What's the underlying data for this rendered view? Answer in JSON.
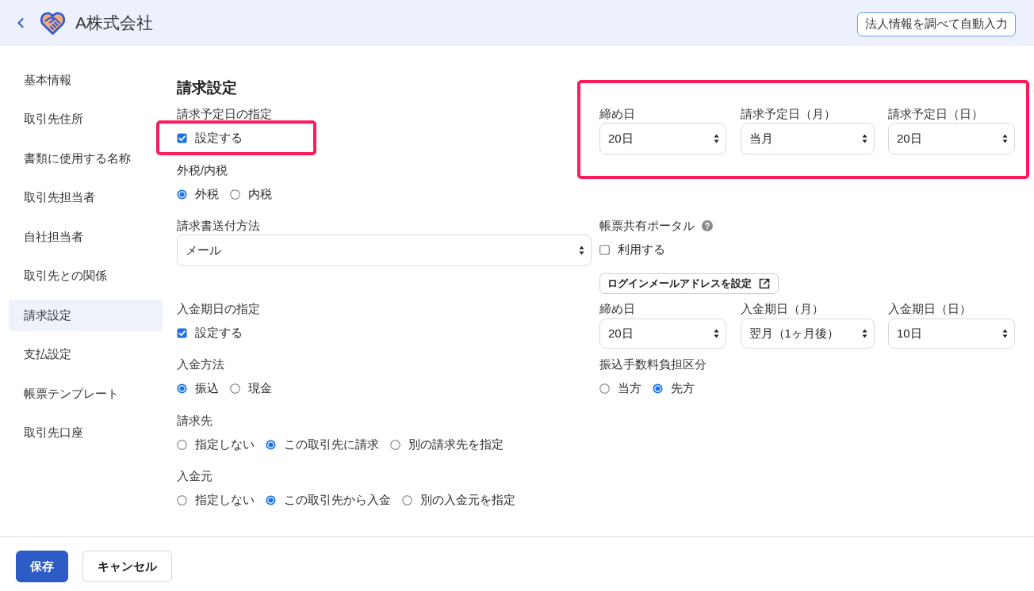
{
  "header": {
    "title": "A株式会社",
    "autofill_button": "法人情報を調べて自動入力"
  },
  "sidebar": {
    "items": [
      {
        "label": "基本情報",
        "selected": false
      },
      {
        "label": "取引先住所",
        "selected": false
      },
      {
        "label": "書類に使用する名称",
        "selected": false
      },
      {
        "label": "取引先担当者",
        "selected": false
      },
      {
        "label": "自社担当者",
        "selected": false
      },
      {
        "label": "取引先との関係",
        "selected": false
      },
      {
        "label": "請求設定",
        "selected": true
      },
      {
        "label": "支払設定",
        "selected": false
      },
      {
        "label": "帳票テンプレート",
        "selected": false
      },
      {
        "label": "取引先口座",
        "selected": false
      }
    ]
  },
  "form": {
    "title": "請求設定",
    "billing_date": {
      "label": "請求予定日の指定",
      "checkbox": {
        "label": "設定する",
        "checked": true
      },
      "highlighted": true
    },
    "billing_date_selects": {
      "highlighted": true,
      "selects": [
        {
          "label": "締め日",
          "value": "20日"
        },
        {
          "label": "請求予定日（月）",
          "value": "当月"
        },
        {
          "label": "請求予定日（日）",
          "value": "20日"
        }
      ]
    },
    "tax": {
      "label": "外税/内税",
      "options": [
        {
          "label": "外税",
          "selected": true
        },
        {
          "label": "内税",
          "selected": false
        }
      ]
    },
    "invoice_delivery": {
      "label": "請求書送付方法",
      "value": "メール"
    },
    "portal": {
      "label": "帳票共有ポータル",
      "checkbox": {
        "label": "利用する",
        "checked": false
      },
      "login_button": "ログインメールアドレスを設定"
    },
    "payment_date": {
      "label": "入金期日の指定",
      "checkbox": {
        "label": "設定する",
        "checked": true
      }
    },
    "payment_date_selects": {
      "selects": [
        {
          "label": "締め日",
          "value": "20日"
        },
        {
          "label": "入金期日（月）",
          "value": "翌月（1ヶ月後）"
        },
        {
          "label": "入金期日（日）",
          "value": "10日"
        }
      ]
    },
    "payment_method": {
      "label": "入金方法",
      "options": [
        {
          "label": "振込",
          "selected": true
        },
        {
          "label": "現金",
          "selected": false
        }
      ]
    },
    "transfer_fee": {
      "label": "振込手数料負担区分",
      "options": [
        {
          "label": "当方",
          "selected": false
        },
        {
          "label": "先方",
          "selected": true
        }
      ]
    },
    "bill_to": {
      "label": "請求先",
      "options": [
        {
          "label": "指定しない",
          "selected": false
        },
        {
          "label": "この取引先に請求",
          "selected": true
        },
        {
          "label": "別の請求先を指定",
          "selected": false
        }
      ]
    },
    "payer": {
      "label": "入金元",
      "options": [
        {
          "label": "指定しない",
          "selected": false
        },
        {
          "label": "この取引先から入金",
          "selected": true
        },
        {
          "label": "別の入金元を指定",
          "selected": false
        }
      ]
    }
  },
  "footer": {
    "buttons": [
      {
        "label": "保存",
        "kind": "primary"
      },
      {
        "label": "キャンセル",
        "kind": "secondary"
      }
    ]
  }
}
